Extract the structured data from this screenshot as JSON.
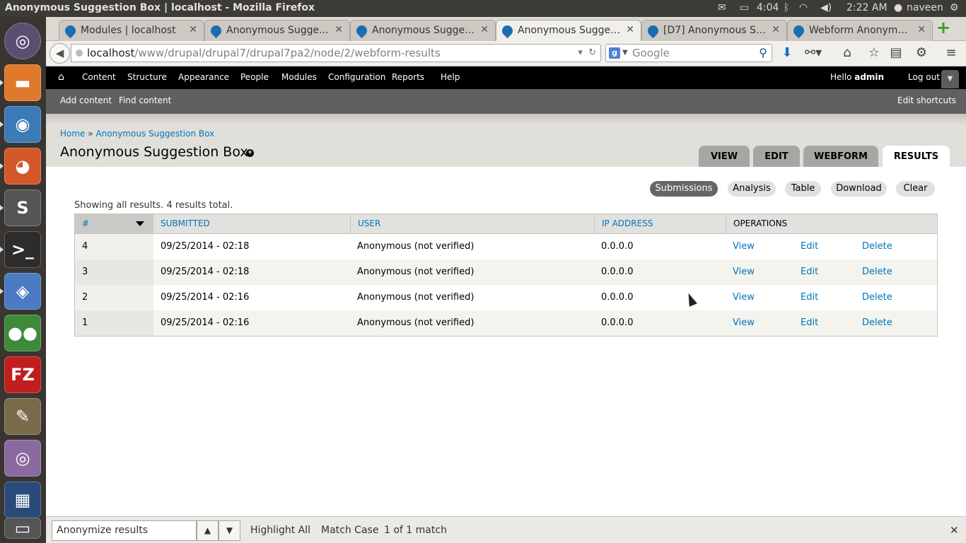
{
  "window": {
    "title": "Anonymous Suggestion Box | localhost - Mozilla Firefox",
    "battery": "4:04",
    "time": "2:22 AM",
    "user": "naveen"
  },
  "launcher": {
    "items": [
      "dash-home",
      "files",
      "chromium",
      "firefox",
      "sublime-text",
      "terminal",
      "virtualbox",
      "cherrytree",
      "filezilla",
      "gimp",
      "cheese",
      "workspace-switcher",
      "trash"
    ]
  },
  "browser": {
    "tabs": [
      {
        "label": "Modules | localhost",
        "active": false
      },
      {
        "label": "Anonymous Sugge...",
        "active": false
      },
      {
        "label": "Anonymous Sugges...",
        "active": false
      },
      {
        "label": "Anonymous Sugges...",
        "active": true
      },
      {
        "label": "[D7] Anonymous Su...",
        "active": false
      },
      {
        "label": "Webform Anonymo...",
        "active": false
      }
    ],
    "url_host": "localhost",
    "url_path": "/www/drupal/drupal7/drupal7pa2/node/2/webform-results",
    "search_placeholder": "Google"
  },
  "admin_toolbar": {
    "menu": [
      "Content",
      "Structure",
      "Appearance",
      "People",
      "Modules",
      "Configuration",
      "Reports",
      "Help"
    ],
    "hello_prefix": "Hello ",
    "hello_user": "admin",
    "logout": "Log out"
  },
  "shortcuts": {
    "add_content": "Add content",
    "find_content": "Find content",
    "edit_shortcuts": "Edit shortcuts"
  },
  "page": {
    "breadcrumb_home": "Home",
    "breadcrumb_sep": "»",
    "breadcrumb_current": "Anonymous Suggestion Box",
    "title": "Anonymous Suggestion Box",
    "tabs": [
      "VIEW",
      "EDIT",
      "WEBFORM",
      "RESULTS"
    ],
    "active_tab": "RESULTS",
    "subtabs": [
      "Submissions",
      "Analysis",
      "Table",
      "Download",
      "Clear"
    ],
    "active_subtab": "Submissions",
    "summary": "Showing all results. 4 results total."
  },
  "results_table": {
    "headers": [
      "#",
      "SUBMITTED",
      "USER",
      "IP ADDRESS",
      "OPERATIONS"
    ],
    "rows": [
      {
        "num": "4",
        "submitted": "09/25/2014 - 02:18",
        "user": "Anonymous (not verified)",
        "ip": "0.0.0.0",
        "ops": [
          "View",
          "Edit",
          "Delete"
        ]
      },
      {
        "num": "3",
        "submitted": "09/25/2014 - 02:18",
        "user": "Anonymous (not verified)",
        "ip": "0.0.0.0",
        "ops": [
          "View",
          "Edit",
          "Delete"
        ]
      },
      {
        "num": "2",
        "submitted": "09/25/2014 - 02:16",
        "user": "Anonymous (not verified)",
        "ip": "0.0.0.0",
        "ops": [
          "View",
          "Edit",
          "Delete"
        ]
      },
      {
        "num": "1",
        "submitted": "09/25/2014 - 02:16",
        "user": "Anonymous (not verified)",
        "ip": "0.0.0.0",
        "ops": [
          "View",
          "Edit",
          "Delete"
        ]
      }
    ]
  },
  "findbar": {
    "value": "Anonymize results",
    "highlight_all": "Highlight All",
    "match_case": "Match Case",
    "status": "1 of 1 match"
  },
  "colors": {
    "link": "#0074bd",
    "toolbar": "#000000",
    "shortcut_bar": "#606060",
    "launcher": "#3a3530"
  }
}
